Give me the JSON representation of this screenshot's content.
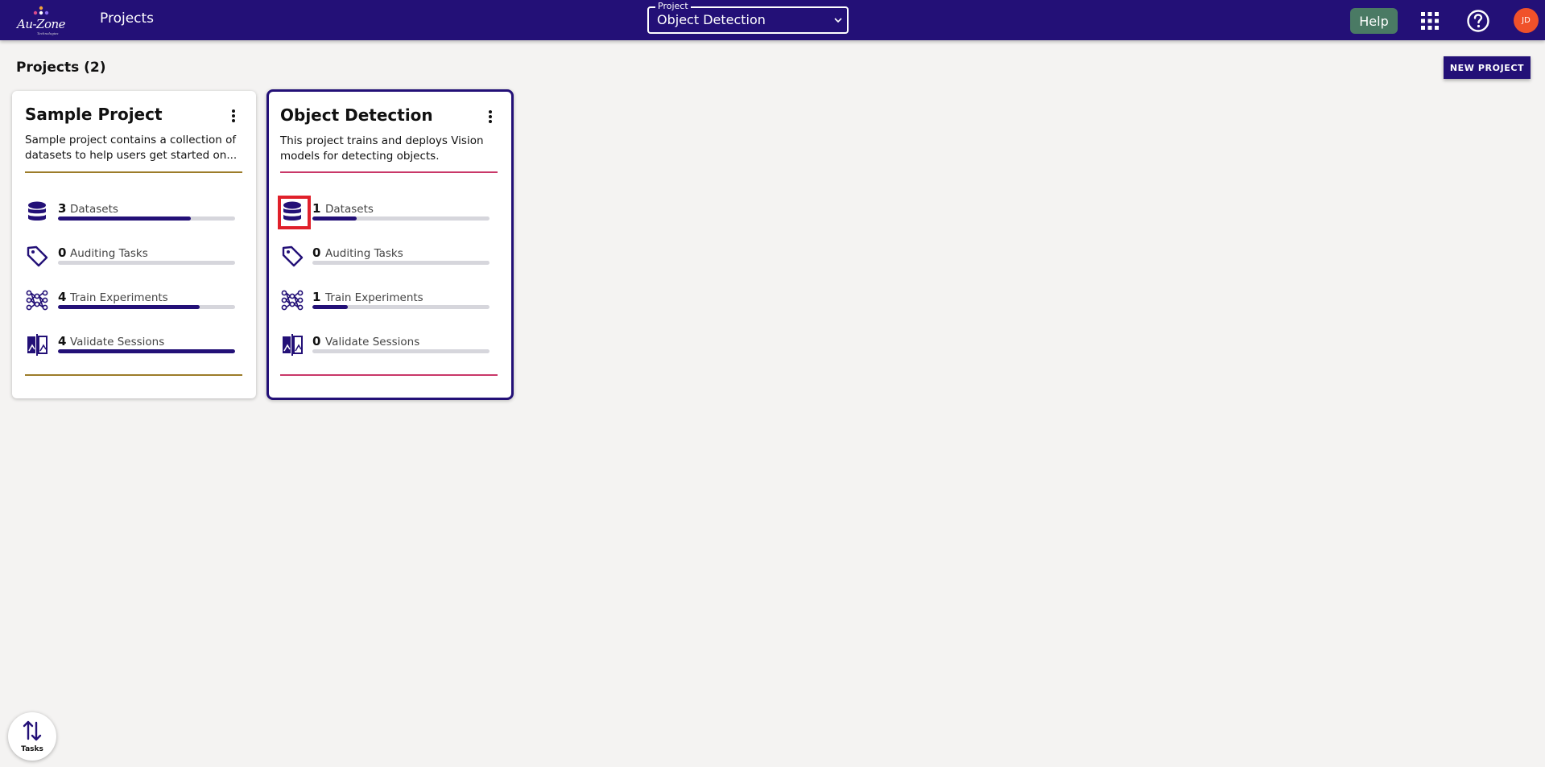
{
  "app": {
    "logo_text": "Au-Zone",
    "logo_subtext": "Technologies",
    "nav_title": "Projects"
  },
  "project_selector": {
    "legend": "Project",
    "value": "Object Detection"
  },
  "toolbar": {
    "help_label": "Help",
    "avatar_initials": "JD"
  },
  "page": {
    "title": "Projects (2)",
    "new_project_label": "NEW PROJECT"
  },
  "colors": {
    "primary": "#231077",
    "sample_accent": "#9c7c29",
    "object_detection_accent": "#c93768",
    "help_button": "#4a7a64",
    "avatar": "#f0512a",
    "highlight": "#e0202a"
  },
  "projects": [
    {
      "name": "Sample Project",
      "description": "Sample project contains a collection of datasets to help users get started on...",
      "stats": [
        {
          "count": "3",
          "label": "Datasets",
          "icon": "database-icon",
          "fill": 0.75
        },
        {
          "count": "0",
          "label": "Auditing Tasks",
          "icon": "tag-icon",
          "fill": 0
        },
        {
          "count": "4",
          "label": "Train Experiments",
          "icon": "network-icon",
          "fill": 0.8
        },
        {
          "count": "4",
          "label": "Validate Sessions",
          "icon": "compare-icon",
          "fill": 1.0
        }
      ]
    },
    {
      "name": "Object Detection",
      "description": "This project trains and deploys Vision models for detecting objects.",
      "stats": [
        {
          "count": "1",
          "label": "Datasets",
          "icon": "database-icon",
          "fill": 0.25
        },
        {
          "count": "0",
          "label": "Auditing Tasks",
          "icon": "tag-icon",
          "fill": 0
        },
        {
          "count": "1",
          "label": "Train Experiments",
          "icon": "network-icon",
          "fill": 0.2
        },
        {
          "count": "0",
          "label": "Validate Sessions",
          "icon": "compare-icon",
          "fill": 0
        }
      ]
    }
  ],
  "tasks_fab": {
    "label": "Tasks"
  }
}
